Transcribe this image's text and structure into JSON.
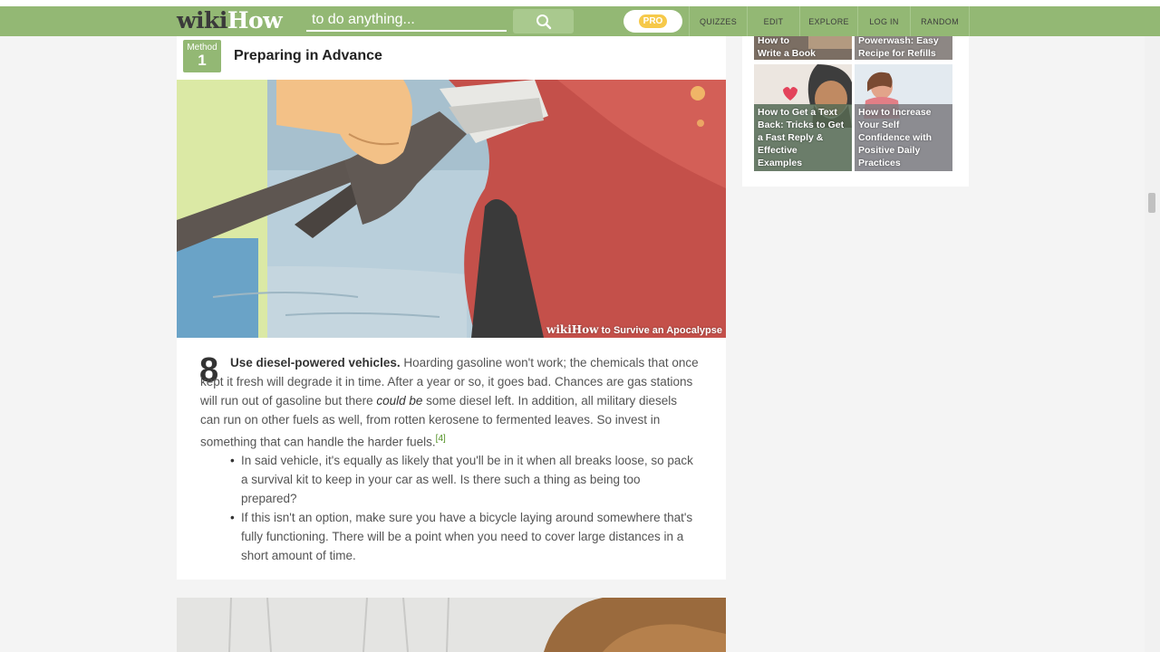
{
  "header": {
    "logo_wiki": "wiki",
    "logo_how": "How",
    "search_placeholder": "to do anything...",
    "pro_label": "PRO",
    "nav": [
      {
        "label": "QUIZZES"
      },
      {
        "label": "EDIT"
      },
      {
        "label": "EXPLORE"
      },
      {
        "label": "LOG IN"
      },
      {
        "label": "RANDOM"
      }
    ]
  },
  "method": {
    "label": "Method",
    "number": "1",
    "title": "Preparing in Advance"
  },
  "image": {
    "watermark_brand": "wikiHow",
    "watermark_text": "to Survive an Apocalypse"
  },
  "step": {
    "number": "8",
    "bold": "Use diesel-powered vehicles.",
    "text1": " Hoarding gasoline won't work; the chemicals that once kept it fresh will degrade it in time. After a year or so, it goes bad. Chances are gas stations will run out of gasoline but there ",
    "italic": "could be",
    "text2": " some diesel left. In addition, all military diesels can run on other fuels as well, from rotten kerosene to fermented leaves. So invest in something that can handle the harder fuels.",
    "ref": "[4]",
    "bullets": [
      "In said vehicle, it's equally as likely that you'll be in it when all breaks loose, so pack a survival kit to keep in your car as well. Is there such a thing as being too prepared?",
      "If this isn't an option, make sure you have a bicycle laying around somewhere that's fully functioning. There will be a point when you need to cover large distances in a short amount of time."
    ]
  },
  "sidebar": {
    "related": [
      {
        "title": "How to Write a Book",
        "lines": [
          "How to",
          "Write a Book"
        ]
      },
      {
        "title": "Powerwash: Easy Recipe for Refills",
        "lines": [
          "Powerwash: Easy",
          "Recipe for Refills"
        ]
      },
      {
        "title": "How to Get a Text Back: Tricks to Get a Fast Reply & Effective Examples",
        "lines": [
          "How to Get a Text",
          "Back: Tricks to Get",
          "a Fast Reply &",
          "Effective",
          "Examples"
        ]
      },
      {
        "title": "How to Increase Your Self Confidence with Positive Daily Practices",
        "lines": [
          "How to Increase",
          "Your Self",
          "Confidence with",
          "Positive Daily",
          "Practices"
        ]
      }
    ]
  },
  "colors": {
    "header_green": "#93b874",
    "ref_green": "#4f8f20",
    "pro_yellow": "#f6c94a"
  }
}
